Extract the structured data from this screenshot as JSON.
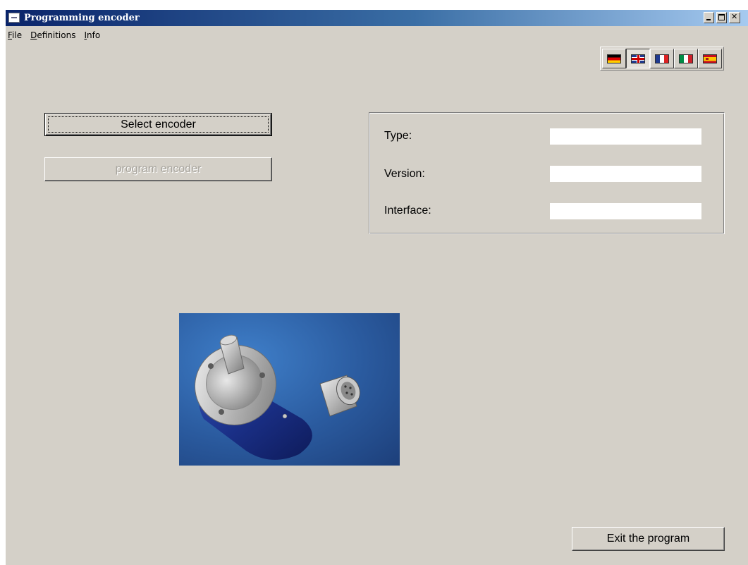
{
  "window": {
    "title": "Programming encoder",
    "icon": "app-icon",
    "controls": [
      "minimize-icon",
      "maximize-icon",
      "close-icon"
    ]
  },
  "menu": {
    "file": {
      "mnemonic": "F",
      "rest": "ile"
    },
    "definitions": {
      "mnemonic": "D",
      "rest": "efinitions"
    },
    "info": {
      "mnemonic": "I",
      "rest": "nfo"
    }
  },
  "languages": [
    {
      "code": "de",
      "icon": "flag-germany-icon",
      "selected": false
    },
    {
      "code": "en",
      "icon": "flag-uk-icon",
      "selected": true
    },
    {
      "code": "fr",
      "icon": "flag-france-icon",
      "selected": false
    },
    {
      "code": "it",
      "icon": "flag-italy-icon",
      "selected": false
    },
    {
      "code": "es",
      "icon": "flag-spain-icon",
      "selected": false
    }
  ],
  "actions": {
    "select_encoder": "Select encoder",
    "program_encoder": "program encoder",
    "exit": "Exit the program"
  },
  "info": {
    "type_label": "Type:",
    "type_value": "",
    "version_label": "Version:",
    "version_value": "",
    "interface_label": "Interface:",
    "interface_value": ""
  },
  "colors": {
    "window_bg": "#d4d0c8",
    "titlebar_start": "#0a246a",
    "titlebar_end": "#a6caf0",
    "image_bg": "#2a5a9e"
  }
}
